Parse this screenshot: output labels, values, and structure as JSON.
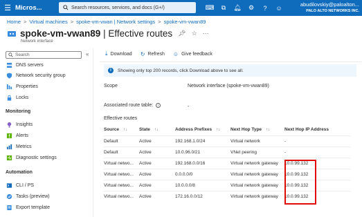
{
  "topbar": {
    "brand": "Micros...",
    "search_placeholder": "Search resources, services, and docs (G+/)",
    "user_name": "abudilovskiy@paloalton...",
    "user_org": "PALO ALTO NETWORKS INC."
  },
  "breadcrumb": [
    "Home",
    "Virtual machines",
    "spoke-vm-vwan | Network settings",
    "spoke-vm-vwan89"
  ],
  "header": {
    "title_main": "spoke-vm-vwan89",
    "title_rest": " | Effective routes",
    "subtitle": "Network interface"
  },
  "sidebar": {
    "search_placeholder": "Search",
    "items_top": [
      {
        "label": "DNS servers",
        "icon": "dns-icon"
      },
      {
        "label": "Network security group",
        "icon": "shield-icon"
      },
      {
        "label": "Properties",
        "icon": "properties-icon"
      },
      {
        "label": "Locks",
        "icon": "lock-icon"
      }
    ],
    "section_monitoring": "Monitoring",
    "items_monitoring": [
      {
        "label": "Insights",
        "icon": "insights-icon"
      },
      {
        "label": "Alerts",
        "icon": "alerts-icon"
      },
      {
        "label": "Metrics",
        "icon": "metrics-icon"
      },
      {
        "label": "Diagnostic settings",
        "icon": "diagnostic-icon"
      }
    ],
    "section_automation": "Automation",
    "items_automation": [
      {
        "label": "CLI / PS",
        "icon": "cli-icon"
      },
      {
        "label": "Tasks (preview)",
        "icon": "tasks-icon"
      },
      {
        "label": "Export template",
        "icon": "export-icon"
      }
    ]
  },
  "toolbar": {
    "download": "Download",
    "refresh": "Refresh",
    "feedback": "Give feedback"
  },
  "info": {
    "message": "Showing only top 200 records, click Download above to see all."
  },
  "details": {
    "scope_label": "Scope",
    "scope_value": "Network interface (spoke-vm-vwan89)",
    "route_table_label": "Associated route table:",
    "route_table_value": "-",
    "effective_routes_label": "Effective routes"
  },
  "table": {
    "headers": [
      "Source",
      "State",
      "Address Prefixes",
      "Next Hop Type",
      "Next Hop IP Address"
    ],
    "rows": [
      [
        "Default",
        "Active",
        "192.168.1.0/24",
        "Virtual network",
        "-"
      ],
      [
        "Default",
        "Active",
        "10.0.96.0/21",
        "VNet peering",
        "-"
      ],
      [
        "Virtual netwo...",
        "Active",
        "192.168.0.0/16",
        "Virtual network gateway",
        "10.0.99.132"
      ],
      [
        "Virtual netwo...",
        "Active",
        "0.0.0.0/0",
        "Virtual network gateway",
        "10.0.99.132"
      ],
      [
        "Virtual netwo...",
        "Active",
        "10.0.0.0/8",
        "Virtual network gateway",
        "10.0.99.132"
      ],
      [
        "Virtual netwo...",
        "Active",
        "172.16.0.0/12",
        "Virtual network gateway",
        "10.0.99.132"
      ]
    ]
  },
  "colors": {
    "accent": "#0f6cbd",
    "highlight": "#e00b00"
  }
}
